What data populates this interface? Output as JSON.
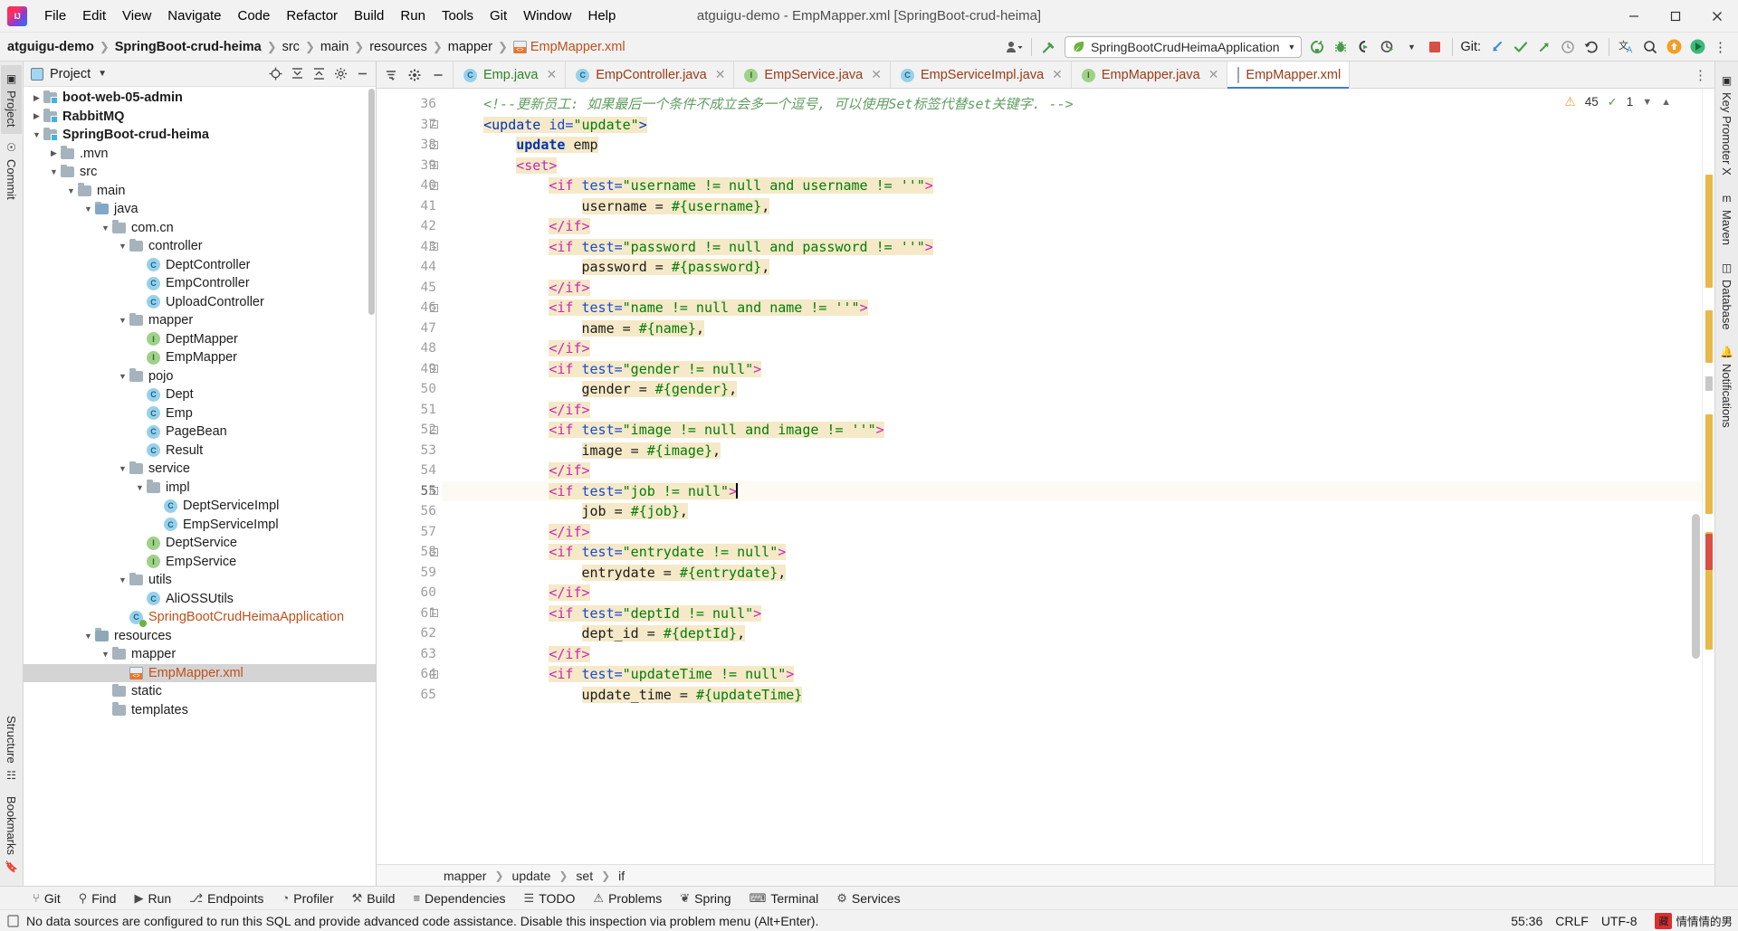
{
  "window": {
    "title": "atguigu-demo - EmpMapper.xml [SpringBoot-crud-heima]",
    "minimize": "─",
    "maximize": "▭",
    "close": "✕"
  },
  "menu": [
    {
      "label": "File"
    },
    {
      "label": "Edit"
    },
    {
      "label": "View"
    },
    {
      "label": "Navigate"
    },
    {
      "label": "Code"
    },
    {
      "label": "Refactor"
    },
    {
      "label": "Build"
    },
    {
      "label": "Run"
    },
    {
      "label": "Tools"
    },
    {
      "label": "Git"
    },
    {
      "label": "Window"
    },
    {
      "label": "Help"
    }
  ],
  "breadcrumbs": [
    {
      "label": "atguigu-demo",
      "bold": true,
      "icon": ""
    },
    {
      "label": "SpringBoot-crud-heima",
      "bold": true,
      "icon": ""
    },
    {
      "label": "src",
      "bold": false,
      "icon": ""
    },
    {
      "label": "main",
      "bold": false,
      "icon": ""
    },
    {
      "label": "resources",
      "bold": false,
      "icon": ""
    },
    {
      "label": "mapper",
      "bold": false,
      "icon": ""
    },
    {
      "label": "EmpMapper.xml",
      "bold": false,
      "icon": "xml-file-icon"
    }
  ],
  "toolbar": {
    "run_config": "SpringBootCrudHeimaApplication",
    "git_label": "Git:",
    "icons": [
      "user-dropdown-icon",
      "build-hammer-icon",
      "rerun-icon",
      "debug-icon",
      "coverage-icon",
      "profiler-icon",
      "stop-icon",
      "git-update-icon",
      "git-commit-icon",
      "git-push-icon",
      "git-history-icon",
      "git-rollback-icon",
      "translate-icon",
      "search-everywhere-icon",
      "upload-icon",
      "play-green-icon",
      "more-icon"
    ]
  },
  "left_strip": {
    "tabs": [
      {
        "label": "Project",
        "active": true,
        "icon": "project-icon"
      },
      {
        "label": "Commit",
        "active": false,
        "icon": "commit-icon"
      },
      {
        "label": "Bookmarks",
        "active": false,
        "icon": "bookmarks-icon"
      },
      {
        "label": "Structure",
        "active": false,
        "icon": "structure-icon"
      }
    ]
  },
  "right_strip": {
    "tabs": [
      {
        "label": "Key Promoter X",
        "icon": "key-promoter-icon"
      },
      {
        "label": "Maven",
        "icon": "maven-icon"
      },
      {
        "label": "Database",
        "icon": "database-icon"
      },
      {
        "label": "Notifications",
        "icon": "notifications-icon"
      }
    ]
  },
  "project_panel": {
    "title": "Project",
    "actions": [
      "locate-icon",
      "collapse-all-icon",
      "expand-all-icon",
      "settings-gear-icon",
      "hide-icon"
    ],
    "tree": [
      {
        "depth": 1,
        "arrow": "right",
        "icon": "folder-module",
        "label": "boot-web-05-admin",
        "bold": true
      },
      {
        "depth": 1,
        "arrow": "right",
        "icon": "folder-module",
        "label": "RabbitMQ",
        "bold": true
      },
      {
        "depth": 1,
        "arrow": "down",
        "icon": "folder-module",
        "label": "SpringBoot-crud-heima",
        "bold": true
      },
      {
        "depth": 2,
        "arrow": "right",
        "icon": "folder",
        "label": ".mvn",
        "bold": false
      },
      {
        "depth": 2,
        "arrow": "down",
        "icon": "folder",
        "label": "src",
        "bold": false
      },
      {
        "depth": 3,
        "arrow": "down",
        "icon": "folder",
        "label": "main",
        "bold": false
      },
      {
        "depth": 4,
        "arrow": "down",
        "icon": "folder-source",
        "label": "java",
        "bold": false
      },
      {
        "depth": 5,
        "arrow": "down",
        "icon": "folder",
        "label": "com.cn",
        "bold": false
      },
      {
        "depth": 6,
        "arrow": "down",
        "icon": "folder",
        "label": "controller",
        "bold": false
      },
      {
        "depth": 7,
        "arrow": "none",
        "icon": "class",
        "label": "DeptController",
        "bold": false
      },
      {
        "depth": 7,
        "arrow": "none",
        "icon": "class",
        "label": "EmpController",
        "bold": false
      },
      {
        "depth": 7,
        "arrow": "none",
        "icon": "class",
        "label": "UploadController",
        "bold": false
      },
      {
        "depth": 6,
        "arrow": "down",
        "icon": "folder",
        "label": "mapper",
        "bold": false
      },
      {
        "depth": 7,
        "arrow": "none",
        "icon": "interface",
        "label": "DeptMapper",
        "bold": false
      },
      {
        "depth": 7,
        "arrow": "none",
        "icon": "interface",
        "label": "EmpMapper",
        "bold": false
      },
      {
        "depth": 6,
        "arrow": "down",
        "icon": "folder",
        "label": "pojo",
        "bold": false
      },
      {
        "depth": 7,
        "arrow": "none",
        "icon": "class",
        "label": "Dept",
        "bold": false
      },
      {
        "depth": 7,
        "arrow": "none",
        "icon": "class",
        "label": "Emp",
        "bold": false
      },
      {
        "depth": 7,
        "arrow": "none",
        "icon": "class",
        "label": "PageBean",
        "bold": false
      },
      {
        "depth": 7,
        "arrow": "none",
        "icon": "class",
        "label": "Result",
        "bold": false
      },
      {
        "depth": 6,
        "arrow": "down",
        "icon": "folder",
        "label": "service",
        "bold": false
      },
      {
        "depth": 7,
        "arrow": "down",
        "icon": "folder",
        "label": "impl",
        "bold": false
      },
      {
        "depth": 8,
        "arrow": "none",
        "icon": "class",
        "label": "DeptServiceImpl",
        "bold": false
      },
      {
        "depth": 8,
        "arrow": "none",
        "icon": "class",
        "label": "EmpServiceImpl",
        "bold": false
      },
      {
        "depth": 7,
        "arrow": "none",
        "icon": "interface",
        "label": "DeptService",
        "bold": false
      },
      {
        "depth": 7,
        "arrow": "none",
        "icon": "interface",
        "label": "EmpService",
        "bold": false
      },
      {
        "depth": 6,
        "arrow": "down",
        "icon": "folder",
        "label": "utils",
        "bold": false
      },
      {
        "depth": 7,
        "arrow": "none",
        "icon": "class",
        "label": "AliOSSUtils",
        "bold": false
      },
      {
        "depth": 6,
        "arrow": "none",
        "icon": "spring-class",
        "label": "SpringBootCrudHeimaApplication",
        "bold": false
      },
      {
        "depth": 4,
        "arrow": "down",
        "icon": "folder-resource",
        "label": "resources",
        "bold": false
      },
      {
        "depth": 5,
        "arrow": "down",
        "icon": "folder",
        "label": "mapper",
        "bold": false
      },
      {
        "depth": 6,
        "arrow": "none",
        "icon": "xml",
        "label": "EmpMapper.xml",
        "bold": false,
        "selected": true
      },
      {
        "depth": 5,
        "arrow": "none",
        "icon": "folder",
        "label": "static",
        "bold": false
      },
      {
        "depth": 5,
        "arrow": "none",
        "icon": "folder",
        "label": "templates",
        "bold": false
      }
    ]
  },
  "editor": {
    "tabs": [
      {
        "label": "Emp.java",
        "icon": "class",
        "color": "green",
        "active": false
      },
      {
        "label": "EmpController.java",
        "icon": "class",
        "color": "orange",
        "active": false
      },
      {
        "label": "EmpService.java",
        "icon": "interface",
        "color": "orange",
        "active": false
      },
      {
        "label": "EmpServiceImpl.java",
        "icon": "class",
        "color": "orange",
        "active": false
      },
      {
        "label": "EmpMapper.java",
        "icon": "interface",
        "color": "orange",
        "active": false
      },
      {
        "label": "EmpMapper.xml",
        "icon": "xml",
        "color": "orange",
        "active": true
      }
    ],
    "inspection": {
      "warnings": "45",
      "checks": "1"
    },
    "first_line": 36,
    "current_line": 55,
    "lines": [
      {
        "n": 36,
        "indent": 1,
        "tokens": [
          {
            "t": "cmt",
            "v": "<!--更新员工: 如果最后一个条件不成立会多一个逗号, 可以使用Set标签代替set关键字. -->"
          }
        ]
      },
      {
        "n": 37,
        "indent": 1,
        "fold": true,
        "tokens": [
          {
            "t": "ang",
            "v": "<update "
          },
          {
            "t": "attr",
            "v": "id="
          },
          {
            "t": "str",
            "v": "\"update\""
          },
          {
            "t": "ang",
            "v": ">"
          }
        ]
      },
      {
        "n": 38,
        "indent": 2,
        "fold": true,
        "tokens": [
          {
            "t": "kw",
            "v": "update"
          },
          {
            "t": "plain",
            "v": " emp"
          }
        ]
      },
      {
        "n": 39,
        "indent": 2,
        "fold": true,
        "tokens": [
          {
            "t": "ifkw",
            "v": "<set>"
          }
        ]
      },
      {
        "n": 40,
        "indent": 3,
        "fold": true,
        "tokens": [
          {
            "t": "ifkw",
            "v": "<if "
          },
          {
            "t": "attr",
            "v": "test="
          },
          {
            "t": "str",
            "v": "\"username != null and username != ''\""
          },
          {
            "t": "ifkw",
            "v": ">"
          }
        ]
      },
      {
        "n": 41,
        "indent": 4,
        "tokens": [
          {
            "t": "plain",
            "v": "username = "
          },
          {
            "t": "mustache",
            "v": "#{username}"
          },
          {
            "t": "plain",
            "v": ","
          }
        ]
      },
      {
        "n": 42,
        "indent": 3,
        "tokens": [
          {
            "t": "ifkw",
            "v": "</if>"
          }
        ]
      },
      {
        "n": 43,
        "indent": 3,
        "fold": true,
        "tokens": [
          {
            "t": "ifkw",
            "v": "<if "
          },
          {
            "t": "attr",
            "v": "test="
          },
          {
            "t": "str",
            "v": "\"password != null and password != ''\""
          },
          {
            "t": "ifkw",
            "v": ">"
          }
        ]
      },
      {
        "n": 44,
        "indent": 4,
        "tokens": [
          {
            "t": "plain",
            "v": "password = "
          },
          {
            "t": "mustache",
            "v": "#{password}"
          },
          {
            "t": "plain",
            "v": ","
          }
        ]
      },
      {
        "n": 45,
        "indent": 3,
        "tokens": [
          {
            "t": "ifkw",
            "v": "</if>"
          }
        ]
      },
      {
        "n": 46,
        "indent": 3,
        "fold": true,
        "tokens": [
          {
            "t": "ifkw",
            "v": "<if "
          },
          {
            "t": "attr",
            "v": "test="
          },
          {
            "t": "str",
            "v": "\"name != null and name != ''\""
          },
          {
            "t": "ifkw",
            "v": ">"
          }
        ]
      },
      {
        "n": 47,
        "indent": 4,
        "tokens": [
          {
            "t": "plain",
            "v": "name = "
          },
          {
            "t": "mustache",
            "v": "#{name}"
          },
          {
            "t": "plain",
            "v": ","
          }
        ]
      },
      {
        "n": 48,
        "indent": 3,
        "tokens": [
          {
            "t": "ifkw",
            "v": "</if>"
          }
        ]
      },
      {
        "n": 49,
        "indent": 3,
        "fold": true,
        "tokens": [
          {
            "t": "ifkw",
            "v": "<if "
          },
          {
            "t": "attr",
            "v": "test="
          },
          {
            "t": "str",
            "v": "\"gender != null\""
          },
          {
            "t": "ifkw",
            "v": ">"
          }
        ]
      },
      {
        "n": 50,
        "indent": 4,
        "tokens": [
          {
            "t": "plain",
            "v": "gender = "
          },
          {
            "t": "mustache",
            "v": "#{gender}"
          },
          {
            "t": "plain",
            "v": ","
          }
        ]
      },
      {
        "n": 51,
        "indent": 3,
        "tokens": [
          {
            "t": "ifkw",
            "v": "</if>"
          }
        ]
      },
      {
        "n": 52,
        "indent": 3,
        "fold": true,
        "tokens": [
          {
            "t": "ifkw",
            "v": "<if "
          },
          {
            "t": "attr",
            "v": "test="
          },
          {
            "t": "str",
            "v": "\"image != null and image != ''\""
          },
          {
            "t": "ifkw",
            "v": ">"
          }
        ]
      },
      {
        "n": 53,
        "indent": 4,
        "tokens": [
          {
            "t": "plain",
            "v": "image = "
          },
          {
            "t": "mustache",
            "v": "#{image}"
          },
          {
            "t": "plain",
            "v": ","
          }
        ]
      },
      {
        "n": 54,
        "indent": 3,
        "tokens": [
          {
            "t": "ifkw",
            "v": "</if>"
          }
        ]
      },
      {
        "n": 55,
        "indent": 3,
        "current": true,
        "caret": true,
        "fold": true,
        "tokens": [
          {
            "t": "ifkw",
            "v": "<if "
          },
          {
            "t": "attr",
            "v": "test="
          },
          {
            "t": "str",
            "v": "\"job != null\""
          },
          {
            "t": "ifkw",
            "v": ">"
          }
        ]
      },
      {
        "n": 56,
        "indent": 4,
        "tokens": [
          {
            "t": "plain",
            "v": "job = "
          },
          {
            "t": "mustache",
            "v": "#{job}"
          },
          {
            "t": "plain",
            "v": ","
          }
        ]
      },
      {
        "n": 57,
        "indent": 3,
        "tokens": [
          {
            "t": "ifkw",
            "v": "</if>"
          }
        ]
      },
      {
        "n": 58,
        "indent": 3,
        "fold": true,
        "tokens": [
          {
            "t": "ifkw",
            "v": "<if "
          },
          {
            "t": "attr",
            "v": "test="
          },
          {
            "t": "str",
            "v": "\"entrydate != null\""
          },
          {
            "t": "ifkw",
            "v": ">"
          }
        ]
      },
      {
        "n": 59,
        "indent": 4,
        "tokens": [
          {
            "t": "plain",
            "v": "entrydate = "
          },
          {
            "t": "mustache",
            "v": "#{entrydate}"
          },
          {
            "t": "plain",
            "v": ","
          }
        ]
      },
      {
        "n": 60,
        "indent": 3,
        "tokens": [
          {
            "t": "ifkw",
            "v": "</if>"
          }
        ]
      },
      {
        "n": 61,
        "indent": 3,
        "fold": true,
        "tokens": [
          {
            "t": "ifkw",
            "v": "<if "
          },
          {
            "t": "attr",
            "v": "test="
          },
          {
            "t": "str",
            "v": "\"deptId != null\""
          },
          {
            "t": "ifkw",
            "v": ">"
          }
        ]
      },
      {
        "n": 62,
        "indent": 4,
        "tokens": [
          {
            "t": "plain",
            "v": "dept_id = "
          },
          {
            "t": "mustache",
            "v": "#{deptId}"
          },
          {
            "t": "plain",
            "v": ","
          }
        ]
      },
      {
        "n": 63,
        "indent": 3,
        "tokens": [
          {
            "t": "ifkw",
            "v": "</if>"
          }
        ]
      },
      {
        "n": 64,
        "indent": 3,
        "fold": true,
        "tokens": [
          {
            "t": "ifkw",
            "v": "<if "
          },
          {
            "t": "attr",
            "v": "test="
          },
          {
            "t": "str",
            "v": "\"updateTime != null\""
          },
          {
            "t": "ifkw",
            "v": ">"
          }
        ]
      },
      {
        "n": 65,
        "indent": 4,
        "tokens": [
          {
            "t": "plain",
            "v": "update_time = "
          },
          {
            "t": "mustache",
            "v": "#{updateTime}"
          }
        ]
      }
    ],
    "breadcrumb": [
      "mapper",
      "update",
      "set",
      "if"
    ]
  },
  "bottom_tools": [
    {
      "label": "Git",
      "icon": "git-branch-icon"
    },
    {
      "label": "Find",
      "icon": "search-icon"
    },
    {
      "label": "Run",
      "icon": "run-icon"
    },
    {
      "label": "Endpoints",
      "icon": "endpoints-icon"
    },
    {
      "label": "Profiler",
      "icon": "profiler-icon"
    },
    {
      "label": "Build",
      "icon": "build-hammer-icon"
    },
    {
      "label": "Dependencies",
      "icon": "dependencies-icon"
    },
    {
      "label": "TODO",
      "icon": "todo-icon"
    },
    {
      "label": "Problems",
      "icon": "problems-icon"
    },
    {
      "label": "Spring",
      "icon": "spring-leaf-icon"
    },
    {
      "label": "Terminal",
      "icon": "terminal-icon"
    },
    {
      "label": "Services",
      "icon": "services-icon"
    }
  ],
  "status_bar": {
    "message": "No data sources are configured to run this SQL and provide advanced code assistance. Disable this inspection via problem menu (Alt+Enter).",
    "position": "55:36",
    "line_sep": "CRLF",
    "encoding": "UTF-8",
    "indent": "",
    "watermark_badge": "藏",
    "watermark_text": "情情情的男"
  },
  "colors": {
    "accent_blue": "#3b7dd8",
    "tab_active_bg": "#ffffff",
    "string_green": "#027d06",
    "tag_magenta": "#c62ab5",
    "attr_blue": "#174ad4",
    "comment_green": "#5f9e60",
    "highlight_yellow": "#f5e9c8",
    "stop_red": "#d94f45",
    "spring_green": "#6db33f"
  }
}
